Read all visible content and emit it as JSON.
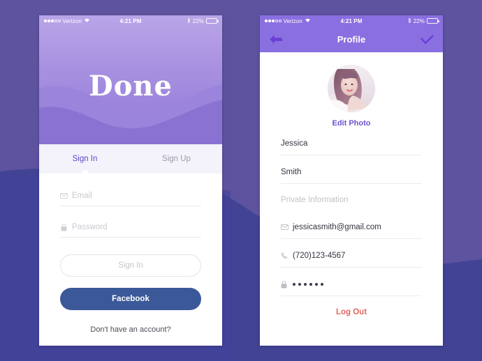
{
  "background": {
    "base_color": "#5d539f",
    "lower_color": "#404295",
    "accent_color": "#6246c8"
  },
  "status_bar": {
    "carrier": "Verizon",
    "time": "4:21 PM",
    "battery_percent": "22%",
    "signal_dots_filled": 3,
    "signal_dots_total": 5,
    "wifi_icon": "wifi-icon",
    "bluetooth_icon": "bluetooth-icon",
    "battery_icon": "battery-icon"
  },
  "signin_screen": {
    "brand": "Done",
    "tabs": [
      {
        "label": "Sign In",
        "active": true
      },
      {
        "label": "Sign Up",
        "active": false
      }
    ],
    "fields": [
      {
        "icon": "envelope-icon",
        "placeholder": "Email"
      },
      {
        "icon": "lock-icon",
        "placeholder": "Password"
      }
    ],
    "primary_button": "Sign In",
    "facebook_button": "Facebook",
    "facebook_color": "#3b5998",
    "footer_link": "Don't have an account?"
  },
  "profile_screen": {
    "nav": {
      "back_icon": "arrow-left-icon",
      "title": "Profile",
      "confirm_icon": "check-icon",
      "header_color": "#8a6fe0"
    },
    "avatar": {
      "alt": "profile-photo",
      "edit_label": "Edit Photo",
      "edit_color": "#6f52cf"
    },
    "fields": [
      {
        "icon": "",
        "value": "Jessica"
      },
      {
        "icon": "",
        "value": "Smith"
      }
    ],
    "section_label": "Private Information",
    "private_fields": [
      {
        "icon": "envelope-icon",
        "value": "jessicasmith@gmail.com",
        "masked": false
      },
      {
        "icon": "phone-icon",
        "value": "(720)123-4567",
        "masked": false
      },
      {
        "icon": "lock-icon",
        "value": "",
        "masked": true,
        "mask_dots": 6
      }
    ],
    "logout_label": "Log Out",
    "logout_color": "#e0675f"
  }
}
